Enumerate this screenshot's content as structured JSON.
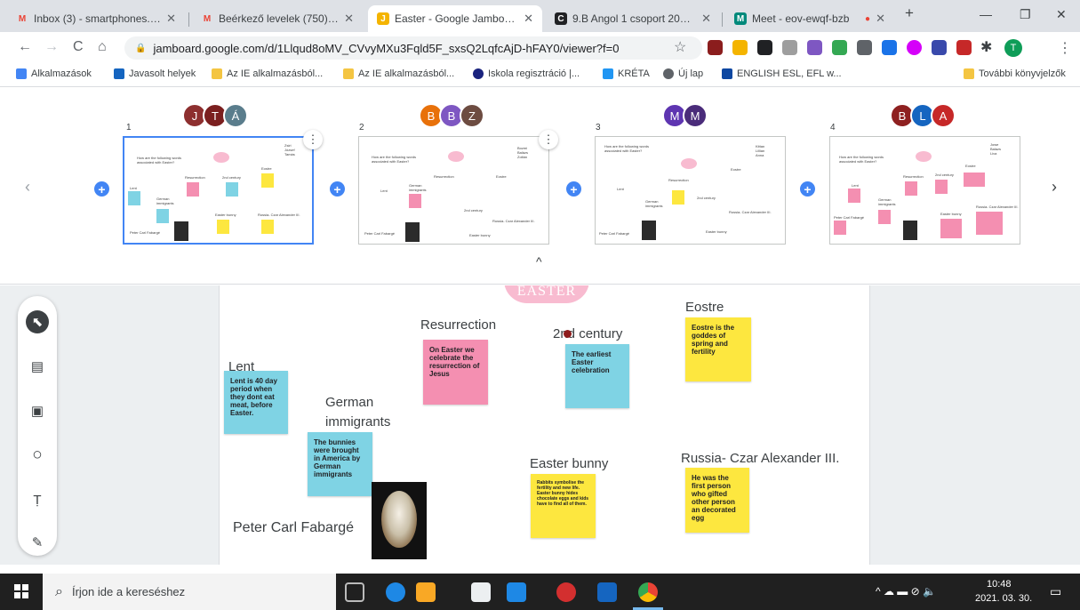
{
  "tabs": [
    {
      "title": "Inbox (3) - smartphones.frie",
      "fav": "M",
      "color": "#ea4335"
    },
    {
      "title": "Beérkező levelek (750) - me",
      "fav": "M",
      "color": "#ea4335"
    },
    {
      "title": "Easter - Google Jamboard",
      "fav": "J",
      "color": "#f4b400"
    },
    {
      "title": "9.B Angol 1 csoport 2020/2",
      "fav": "C",
      "color": "#202124"
    },
    {
      "title": "Meet - eov-ewqf-bzb",
      "fav": "M",
      "color": "#00897b"
    }
  ],
  "window": {
    "new_tab": "+",
    "minimize": "—",
    "maximize": "❐",
    "close": "✕"
  },
  "nav": {
    "back": "←",
    "forward": "→",
    "reload": "C",
    "home": "⌂",
    "star": "☆"
  },
  "url": "jamboard.google.com/d/1Llqud8oMV_CVvyMXu3Fqld5F_sxsQ2LqfcAjD-hFAY0/viewer?f=0",
  "lock": "🔒",
  "profile_initial": "T",
  "bookmarks": [
    {
      "label": "Alkalmazások",
      "color": "#4285f4"
    },
    {
      "label": "Javasolt helyek",
      "color": "#1565c0"
    },
    {
      "label": "Az IE alkalmazásból...",
      "color": "#f4c542"
    },
    {
      "label": "Az IE alkalmazásból...",
      "color": "#f4c542"
    },
    {
      "label": "Iskola regisztráció |...",
      "color": "#1a237e"
    },
    {
      "label": "KRÉTA",
      "color": "#2196f3"
    },
    {
      "label": "Új lap",
      "color": "#5f6368"
    },
    {
      "label": "ENGLISH ESL, EFL w...",
      "color": "#0d47a1"
    }
  ],
  "bookmarks_other": "További könyvjelzők",
  "frames": [
    {
      "number": "1",
      "avatars": [
        {
          "letter": "J",
          "color": "#8d2f2f"
        },
        {
          "letter": "T",
          "color": "#7b1f1f"
        },
        {
          "letter": "Á",
          "color": "#5a7d8c"
        }
      ]
    },
    {
      "number": "2",
      "avatars": [
        {
          "letter": "B",
          "color": "#e8710a"
        },
        {
          "letter": "B",
          "color": "#7e57c2"
        },
        {
          "letter": "Z",
          "color": "#6d4c41"
        }
      ]
    },
    {
      "number": "3",
      "avatars": [
        {
          "letter": "M",
          "color": "#5e35b1"
        },
        {
          "letter": "M",
          "color": "#4a2c7a"
        }
      ]
    },
    {
      "number": "4",
      "avatars": [
        {
          "letter": "B",
          "color": "#8e2020"
        },
        {
          "letter": "L",
          "color": "#1565c0"
        },
        {
          "letter": "A",
          "color": "#c62828"
        }
      ]
    }
  ],
  "mini": {
    "question": "How are the following words associated with Easter?",
    "names1": "Zsiri\nJózsef\nTamás",
    "names2": "Bozmi\nBalázs\nZoltán",
    "names3": "Kittan\nLillian\nAnna",
    "names4": "Jowe\nBalazs\nLiva",
    "lent": "Lent",
    "german": "German\nimmigrants",
    "resurrection": "Resurrection",
    "century": "2nd century",
    "eostre": "Eostre",
    "bunny": "Easter bunny",
    "russia": "Russia- Czar Alexander III.",
    "peter": "Peter Carl Fabargé"
  },
  "filmstrip": {
    "prev": "‹",
    "next": "›",
    "collapse": "^",
    "add": "+",
    "more": "⋮"
  },
  "tools": {
    "select": "⬉",
    "note": "▤",
    "image": "▣",
    "circle": "○",
    "text": "Ṭ",
    "laser": "✎"
  },
  "board": {
    "logo": "EASTER",
    "labels": {
      "lent": "Lent",
      "german": "German\nimmigrants",
      "resurrection": "Resurrection",
      "century": "2nd century",
      "eostre": "Eostre",
      "bunny": "Easter bunny",
      "russia": "Russia- Czar Alexander III.",
      "peter": "Peter Carl Fabargé"
    },
    "notes": {
      "lent": "Lent is 40 day period when they dont eat meat, before Easter.",
      "german": "The bunnies were brought in America by German immigrants",
      "resurrection": "On Easter we celebrate the resurrection of Jesus",
      "century": "The earliest Easter celebration",
      "eostre": "Eostre is the goddes of spring and fertility",
      "bunny": "Rabbits symbolise the fertility and new life. Easter bunny hides chocolate eggs and kids have to find all of them.",
      "russia": "He was the first person who gifted other person an decorated egg"
    },
    "colors": {
      "blue": "#7fd3e4",
      "pink": "#f48fb1",
      "yellow": "#fde73f"
    }
  },
  "taskbar": {
    "search_placeholder": "Írjon ide a kereséshez",
    "search_icon": "⌕",
    "time": "10:48",
    "date": "2021. 03. 30.",
    "tray": "^ ☁ ▬ ⊘ 🔈"
  }
}
